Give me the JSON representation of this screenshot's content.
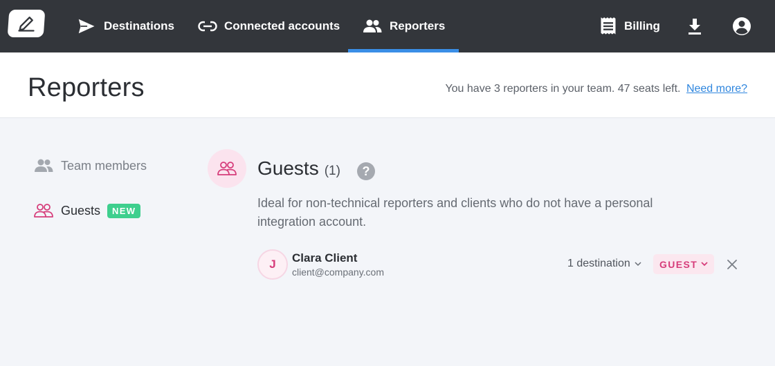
{
  "nav": {
    "items": [
      {
        "label": "Destinations",
        "icon": "send-icon"
      },
      {
        "label": "Connected accounts",
        "icon": "link-icon"
      },
      {
        "label": "Reporters",
        "icon": "people-icon",
        "active": true
      },
      {
        "label": "Billing",
        "icon": "receipt-icon"
      }
    ],
    "download_icon": "download-icon",
    "account_icon": "account-circle-icon",
    "logo_icon": "pen-icon",
    "accent_color": "#3a8ee6"
  },
  "header": {
    "title": "Reporters",
    "team_info": "You have 3 reporters in your team. 47 seats left.",
    "need_more_link": "Need more?"
  },
  "sidebar": {
    "items": [
      {
        "label": "Team members",
        "icon": "people-icon"
      },
      {
        "label": "Guests",
        "icon": "guests-icon",
        "badge": "NEW",
        "selected": true
      }
    ],
    "badge_color": "#3ecf8e"
  },
  "group": {
    "title": "Guests",
    "count": "(1)",
    "help_icon": "?",
    "description": "Ideal for non-technical reporters and clients who do not have a personal integration account."
  },
  "members": [
    {
      "initial": "J",
      "name": "Clara Client",
      "email": "client@company.com",
      "destinations": "1 destination",
      "role": "GUEST",
      "role_color": "#d63c7a"
    }
  ]
}
